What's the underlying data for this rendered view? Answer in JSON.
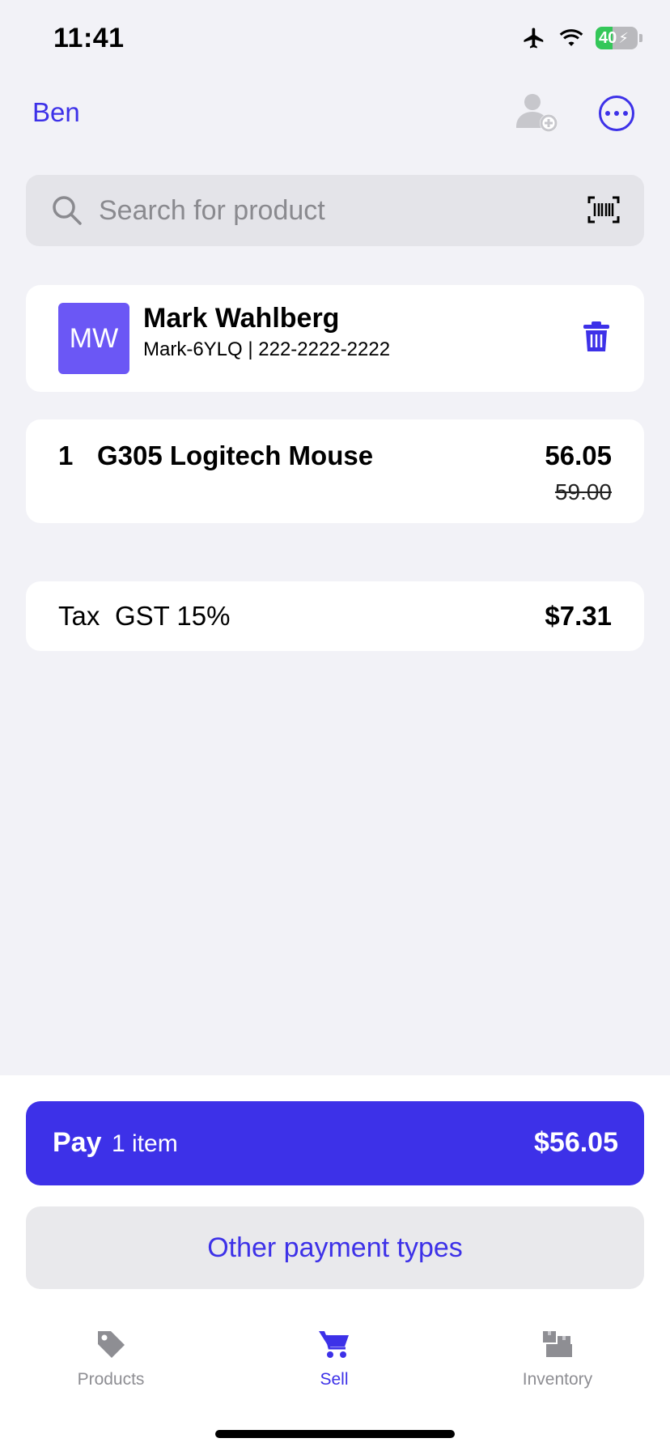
{
  "status_bar": {
    "time": "11:41",
    "battery_level": "40"
  },
  "nav": {
    "user_name": "Ben"
  },
  "search": {
    "placeholder": "Search for product"
  },
  "customer": {
    "initials": "MW",
    "name": "Mark Wahlberg",
    "details": "Mark-6YLQ | 222-2222-2222"
  },
  "cart": {
    "items": [
      {
        "qty": "1",
        "name": "G305 Logitech Mouse",
        "price": "56.05",
        "original_price": "59.00"
      }
    ]
  },
  "tax": {
    "label": "Tax",
    "name": "GST 15%",
    "amount": "$7.31"
  },
  "pay": {
    "label": "Pay",
    "count": "1 item",
    "total": "$56.05"
  },
  "other_payment": {
    "label": "Other payment types"
  },
  "tabs": [
    {
      "label": "Products",
      "icon": "tag-icon",
      "active": false
    },
    {
      "label": "Sell",
      "icon": "cart-icon",
      "active": true
    },
    {
      "label": "Inventory",
      "icon": "boxes-icon",
      "active": false
    }
  ],
  "colors": {
    "accent": "#3d31e8",
    "avatar": "#6b57f5",
    "background": "#f2f2f7",
    "battery": "#34c759"
  }
}
